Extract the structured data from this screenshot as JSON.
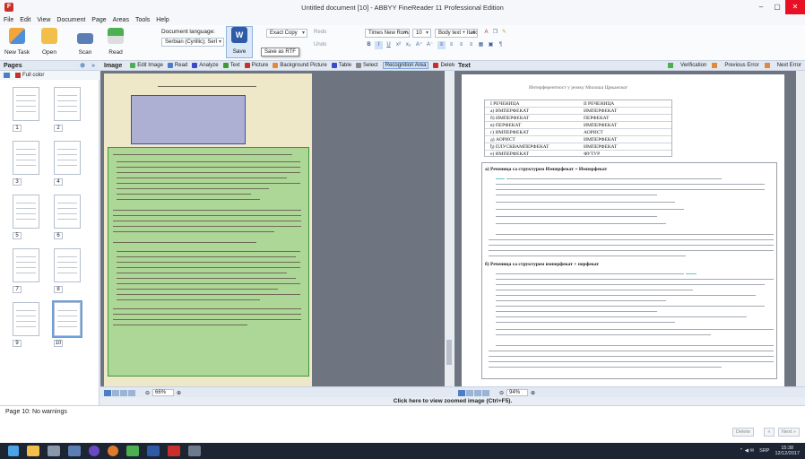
{
  "window": {
    "title": "Untitled document [10] - ABBYY FineReader 11 Professional Edition",
    "min_label": "–",
    "max_label": "▢",
    "close_label": "✕"
  },
  "menu": [
    "File",
    "Edit",
    "View",
    "Document",
    "Page",
    "Areas",
    "Tools",
    "Help"
  ],
  "ribbon": {
    "new_task": "New Task",
    "open": "Open",
    "scan": "Scan",
    "read": "Read",
    "save": "Save",
    "doc_language_label": "Document language:",
    "doc_language_value": "Serbian (Cyrillic); Serl",
    "save_mode": "Exact Copy",
    "save_tooltip": "Save as RTF",
    "redo": "Redo",
    "undo": "Undo",
    "font_name": "Times New Roman",
    "font_size": "10",
    "style": "Body text + Italic"
  },
  "pages_panel": {
    "title": "Pages",
    "filter": "Full color",
    "pages": [
      "1",
      "2",
      "3",
      "4",
      "5",
      "6",
      "7",
      "8",
      "9",
      "10"
    ],
    "selected_page": "10"
  },
  "image_panel": {
    "title": "Image",
    "tools": [
      "Edit Image",
      "Read",
      "Analyze",
      "Text",
      "Picture",
      "Background Picture",
      "Table",
      "Select",
      "Recognition Area",
      "Delete"
    ],
    "active_tool": "Recognition Area",
    "zoom": "66%"
  },
  "text_panel": {
    "title": "Text",
    "tools": [
      "Verification",
      "Previous Error",
      "Next Error"
    ],
    "zoom": "94%",
    "heading": "Интерферентност у језику Милоша Црњанског",
    "section_a": "а) Реченица са структуром Имперфекат + Имперфекат",
    "section_b": "б) Реченица са структуром имперфекат + перфекат",
    "table_rows": [
      [
        "I РЕЧЕНИЦА",
        "II РЕЧЕНИЦА"
      ],
      [
        "а) ИМПЕРФЕКАТ",
        "ИМПЕРФЕКАТ"
      ],
      [
        "б) ИМПЕРФЕКАТ",
        "ПЕРФЕКАТ"
      ],
      [
        "в) ПЕРФЕКАТ",
        "ИМПЕРФЕКАТ"
      ],
      [
        "г) ИМПЕРФЕКАТ",
        "АОРИСТ"
      ],
      [
        "д) АОРИСТ",
        "ИМПЕРФЕКАТ"
      ],
      [
        "ђ) ПЛУСКВАМПЕРФЕКАТ",
        "ИМПЕРФЕКАТ"
      ],
      [
        "е) ИМПЕРФЕКАТ",
        "ФУТУР"
      ]
    ]
  },
  "zoomed_hint": "Click here to view zoomed image (Ctrl+F5).",
  "warnings": {
    "text": "Page 10: No warnings",
    "delete": "Delete",
    "next": "Next »",
    "back": "«"
  },
  "tray": {
    "lang": "SRP",
    "time": "15:38",
    "date": "12/12/2017"
  },
  "colors": {
    "accent": "#4d7ec4",
    "recognition_text": "#3d9a34",
    "recognition_table": "#3c49c9",
    "taskbar": "#1d2533"
  }
}
